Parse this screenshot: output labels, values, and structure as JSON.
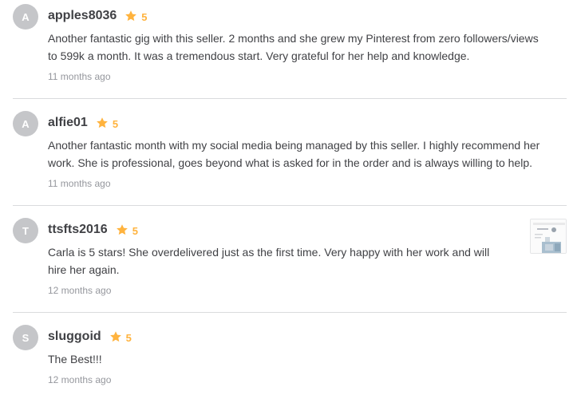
{
  "reviews": [
    {
      "initial": "A",
      "username": "apples8036",
      "rating": "5",
      "text": "Another fantastic gig with this seller. 2 months and she grew my Pinterest from zero followers/views to 599k a month. It was a tremendous start. Very grateful for her help and knowledge.",
      "time": "11 months ago"
    },
    {
      "initial": "A",
      "username": "alfie01",
      "rating": "5",
      "text": "Another fantastic month with my social media being managed by this seller. I highly recommend her work. She is professional, goes beyond what is asked for in the order and is always willing to help.",
      "time": "11 months ago"
    },
    {
      "initial": "T",
      "username": "ttsfts2016",
      "rating": "5",
      "text": "Carla is 5 stars! She overdelivered just as the first time. Very happy with her work and will hire her again.",
      "time": "12 months ago",
      "has_attachment": true
    },
    {
      "initial": "S",
      "username": "sluggoid",
      "rating": "5",
      "text": "The Best!!!",
      "time": "12 months ago"
    }
  ],
  "colors": {
    "star": "#ffb33e",
    "avatar_bg": "#c5c6c9",
    "divider": "#dadbdd",
    "muted_text": "#95979d"
  },
  "icons": {
    "rating": "star-icon"
  }
}
